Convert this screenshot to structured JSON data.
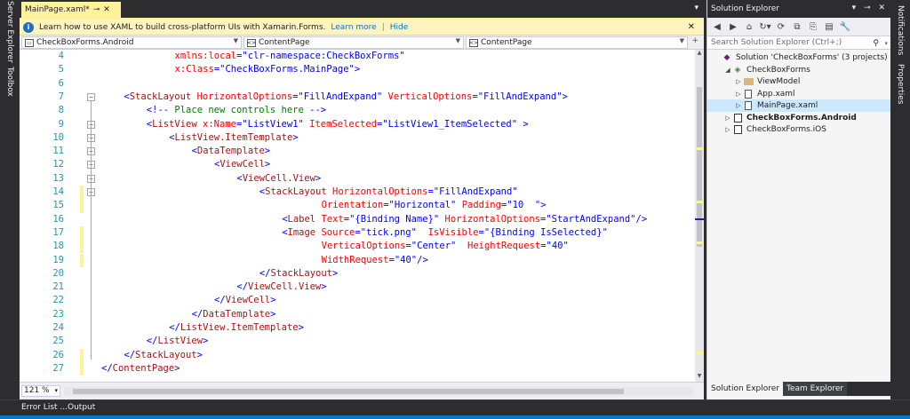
{
  "left_strip": {
    "server_explorer": "Server Explorer",
    "toolbox": "Toolbox"
  },
  "right_strip": {
    "notifications": "Notifications",
    "properties": "Properties"
  },
  "editor": {
    "tab": {
      "title": "MainPage.xaml*",
      "pin": "⊸",
      "close": "✕"
    },
    "tab_dropdown": "▾",
    "infobar": {
      "message": "Learn how to use XAML to build cross-platform UIs with Xamarin.Forms.",
      "learn_more": "Learn more",
      "separator": "|",
      "hide": "Hide",
      "close": "✕"
    },
    "navbar": {
      "project": "CheckBoxForms.Android",
      "type": "ContentPage",
      "member": "ContentPage",
      "split": "+"
    },
    "code_lines": [
      {
        "n": "4",
        "parts": [
          {
            "c": "t-at",
            "t": "xmlns:"
          },
          {
            "c": "t-at",
            "t": "local"
          },
          {
            "c": "t-br",
            "t": "="
          },
          {
            "c": "t-va",
            "t": "\"clr-namespace:CheckBoxForms\""
          }
        ]
      },
      {
        "n": "5",
        "parts": [
          {
            "c": "t-at",
            "t": "x:Class"
          },
          {
            "c": "t-br",
            "t": "="
          },
          {
            "c": "t-va",
            "t": "\"CheckBoxForms.MainPage\""
          },
          {
            "c": "t-br",
            "t": ">"
          }
        ]
      },
      {
        "n": "6",
        "parts": []
      },
      {
        "n": "7",
        "parts": [
          {
            "c": "t-br",
            "t": "<"
          },
          {
            "c": "t-el",
            "t": "StackLayout"
          },
          {
            "c": "t-at",
            "t": " HorizontalOptions"
          },
          {
            "c": "t-br",
            "t": "="
          },
          {
            "c": "t-va",
            "t": "\"FillAndExpand\""
          },
          {
            "c": "t-at",
            "t": " VerticalOptions"
          },
          {
            "c": "t-br",
            "t": "="
          },
          {
            "c": "t-va",
            "t": "\"FillAndExpand\""
          },
          {
            "c": "t-br",
            "t": ">"
          }
        ]
      },
      {
        "n": "8",
        "parts": [
          {
            "c": "t-br",
            "t": "<!--"
          },
          {
            "c": "t-cm",
            "t": " Place new controls here "
          },
          {
            "c": "t-br",
            "t": "-->"
          }
        ]
      },
      {
        "n": "9",
        "parts": [
          {
            "c": "t-br",
            "t": "<"
          },
          {
            "c": "t-el",
            "t": "ListView"
          },
          {
            "c": "t-at",
            "t": " x:Name"
          },
          {
            "c": "t-br",
            "t": "="
          },
          {
            "c": "t-va",
            "t": "\"ListView1\""
          },
          {
            "c": "t-at",
            "t": " ItemSelected"
          },
          {
            "c": "t-br",
            "t": "="
          },
          {
            "c": "t-va",
            "t": "\"ListView1_ItemSelected\""
          },
          {
            "c": "t-br",
            "t": " >"
          }
        ]
      },
      {
        "n": "10",
        "parts": [
          {
            "c": "t-br",
            "t": "<"
          },
          {
            "c": "t-el",
            "t": "ListView.ItemTemplate"
          },
          {
            "c": "t-br",
            "t": ">"
          }
        ]
      },
      {
        "n": "11",
        "parts": [
          {
            "c": "t-br",
            "t": "<"
          },
          {
            "c": "t-el",
            "t": "DataTemplate"
          },
          {
            "c": "t-br",
            "t": ">"
          }
        ]
      },
      {
        "n": "12",
        "parts": [
          {
            "c": "t-br",
            "t": "<"
          },
          {
            "c": "t-el",
            "t": "ViewCell"
          },
          {
            "c": "t-br",
            "t": ">"
          }
        ]
      },
      {
        "n": "13",
        "parts": [
          {
            "c": "t-br",
            "t": "<"
          },
          {
            "c": "t-el",
            "t": "ViewCell.View"
          },
          {
            "c": "t-br",
            "t": ">"
          }
        ]
      },
      {
        "n": "14",
        "parts": [
          {
            "c": "t-br",
            "t": "<"
          },
          {
            "c": "t-el",
            "t": "StackLayout"
          },
          {
            "c": "t-at",
            "t": " HorizontalOptions"
          },
          {
            "c": "t-br",
            "t": "="
          },
          {
            "c": "t-va",
            "t": "\"FillAndExpand\""
          }
        ]
      },
      {
        "n": "15",
        "parts": [
          {
            "c": "t-at",
            "t": "Orientation"
          },
          {
            "c": "t-br",
            "t": "="
          },
          {
            "c": "t-va",
            "t": "\"Horizontal\""
          },
          {
            "c": "t-at",
            "t": " Padding"
          },
          {
            "c": "t-br",
            "t": "="
          },
          {
            "c": "t-va",
            "t": "\"10  \""
          },
          {
            "c": "t-br",
            "t": ">"
          }
        ]
      },
      {
        "n": "16",
        "parts": [
          {
            "c": "t-br",
            "t": "<"
          },
          {
            "c": "t-el",
            "t": "Label"
          },
          {
            "c": "t-at",
            "t": " Text"
          },
          {
            "c": "t-br",
            "t": "="
          },
          {
            "c": "t-va",
            "t": "\"{Binding Name}\""
          },
          {
            "c": "t-at",
            "t": " HorizontalOptions"
          },
          {
            "c": "t-br",
            "t": "="
          },
          {
            "c": "t-va",
            "t": "\"StartAndExpand\""
          },
          {
            "c": "t-br",
            "t": "/>"
          }
        ]
      },
      {
        "n": "17",
        "parts": [
          {
            "c": "t-br",
            "t": "<"
          },
          {
            "c": "t-el",
            "t": "Image"
          },
          {
            "c": "t-at",
            "t": " Source"
          },
          {
            "c": "t-br",
            "t": "="
          },
          {
            "c": "t-va",
            "t": "\"tick.png\""
          },
          {
            "c": "t-at",
            "t": "  IsVisible"
          },
          {
            "c": "t-br",
            "t": "="
          },
          {
            "c": "t-va",
            "t": "\"{Binding IsSelected}\""
          }
        ]
      },
      {
        "n": "18",
        "parts": [
          {
            "c": "t-at",
            "t": "VerticalOptions"
          },
          {
            "c": "t-br",
            "t": "="
          },
          {
            "c": "t-va",
            "t": "\"Center\""
          },
          {
            "c": "t-at",
            "t": "  HeightRequest"
          },
          {
            "c": "t-br",
            "t": "="
          },
          {
            "c": "t-va",
            "t": "\"40\""
          }
        ]
      },
      {
        "n": "19",
        "parts": [
          {
            "c": "t-at",
            "t": "WidthRequest"
          },
          {
            "c": "t-br",
            "t": "="
          },
          {
            "c": "t-va",
            "t": "\"40\""
          },
          {
            "c": "t-br",
            "t": "/>"
          }
        ]
      },
      {
        "n": "20",
        "parts": [
          {
            "c": "t-br",
            "t": "</"
          },
          {
            "c": "t-el",
            "t": "StackLayout"
          },
          {
            "c": "t-br",
            "t": ">"
          }
        ]
      },
      {
        "n": "21",
        "parts": [
          {
            "c": "t-br",
            "t": "</"
          },
          {
            "c": "t-el",
            "t": "ViewCell.View"
          },
          {
            "c": "t-br",
            "t": ">"
          }
        ]
      },
      {
        "n": "22",
        "parts": [
          {
            "c": "t-br",
            "t": "</"
          },
          {
            "c": "t-el",
            "t": "ViewCell"
          },
          {
            "c": "t-br",
            "t": ">"
          }
        ]
      },
      {
        "n": "23",
        "parts": [
          {
            "c": "t-br",
            "t": "</"
          },
          {
            "c": "t-el",
            "t": "DataTemplate"
          },
          {
            "c": "t-br",
            "t": ">"
          }
        ]
      },
      {
        "n": "24",
        "parts": [
          {
            "c": "t-br",
            "t": "</"
          },
          {
            "c": "t-el",
            "t": "ListView.ItemTemplate"
          },
          {
            "c": "t-br",
            "t": ">"
          }
        ]
      },
      {
        "n": "25",
        "parts": [
          {
            "c": "t-br",
            "t": "</"
          },
          {
            "c": "t-el",
            "t": "ListView"
          },
          {
            "c": "t-br",
            "t": ">"
          }
        ]
      },
      {
        "n": "26",
        "parts": [
          {
            "c": "t-br",
            "t": "</"
          },
          {
            "c": "t-el",
            "t": "StackLayout"
          },
          {
            "c": "t-br",
            "t": ">"
          }
        ]
      },
      {
        "n": "27",
        "parts": [
          {
            "c": "t-br",
            "t": "</"
          },
          {
            "c": "t-el",
            "t": "ContentPage"
          },
          {
            "c": "t-br",
            "t": ">"
          }
        ]
      }
    ],
    "zoom": "121 %",
    "zoom_arrow": "▾"
  },
  "solution_explorer": {
    "title": "Solution Explorer",
    "title_controls": "▾ ⊸ ✕",
    "toolbar_icons": [
      "◀",
      "▶",
      "⌂",
      "↻▾",
      "⟳",
      "⧉",
      "⎘",
      "▤",
      "🔧"
    ],
    "search_placeholder": "Search Solution Explorer (Ctrl+;)",
    "search_icon": "⚲",
    "search_arrow": "▾",
    "tree": [
      {
        "label": "Solution 'CheckBoxForms' (3 projects)",
        "exp": "",
        "icon": "sol",
        "depth": 0
      },
      {
        "label": "CheckBoxForms",
        "exp": "◢",
        "icon": "proj",
        "depth": 1
      },
      {
        "label": "ViewModel",
        "exp": "▷",
        "icon": "folder",
        "depth": 2
      },
      {
        "label": "App.xaml",
        "exp": "▷",
        "icon": "file",
        "depth": 2
      },
      {
        "label": "MainPage.xaml",
        "exp": "▷",
        "icon": "file",
        "depth": 2,
        "selected": true
      },
      {
        "label": "CheckBoxForms.Android",
        "exp": "▷",
        "icon": "android",
        "depth": 1,
        "bold": true
      },
      {
        "label": "CheckBoxForms.iOS",
        "exp": "▷",
        "icon": "android",
        "depth": 1
      }
    ],
    "tabs": {
      "solution_explorer": "Solution Explorer",
      "team_explorer": "Team Explorer"
    }
  },
  "bottom_tabs": {
    "error_list": "Error List ...",
    "output": "Output"
  },
  "colors": {
    "accent": "#007acc",
    "tab_modified": "#fff29d",
    "selected_item": "#cce8ff"
  }
}
